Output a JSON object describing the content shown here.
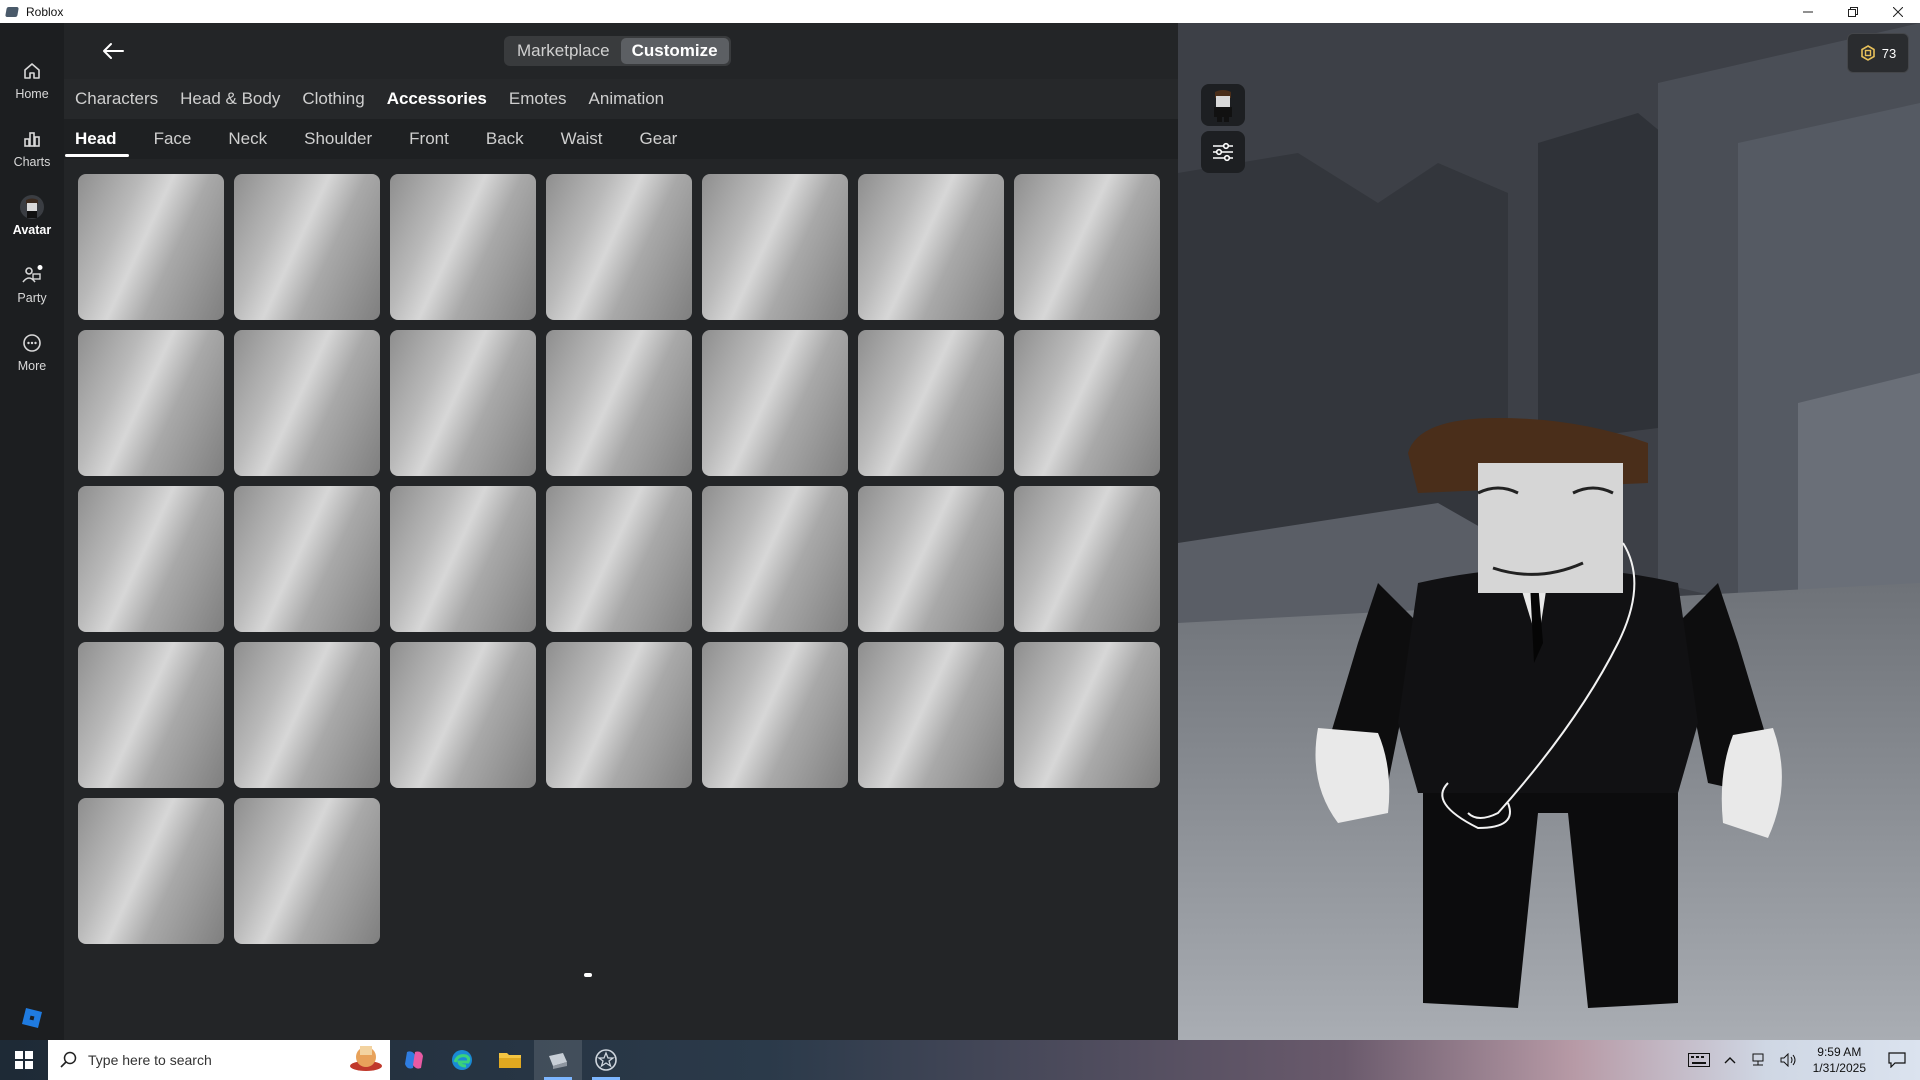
{
  "window": {
    "title": "Roblox"
  },
  "nav": [
    {
      "label": "Home"
    },
    {
      "label": "Charts"
    },
    {
      "label": "Avatar"
    },
    {
      "label": "Party"
    },
    {
      "label": "More"
    }
  ],
  "topbar": {
    "marketplace": "Marketplace",
    "customize": "Customize"
  },
  "categories": [
    "Characters",
    "Head & Body",
    "Clothing",
    "Accessories",
    "Emotes",
    "Animation"
  ],
  "subcategories": [
    "Head",
    "Face",
    "Neck",
    "Shoulder",
    "Front",
    "Back",
    "Waist",
    "Gear"
  ],
  "item_count": 30,
  "robux": {
    "balance": "73"
  },
  "taskbar": {
    "search_placeholder": "Type here to search",
    "time": "9:59 AM",
    "date": "1/31/2025"
  },
  "colors": {
    "panel": "#232527",
    "nav": "#1c1e20",
    "accent": "#ffffff",
    "logo": "#1f7be0"
  }
}
